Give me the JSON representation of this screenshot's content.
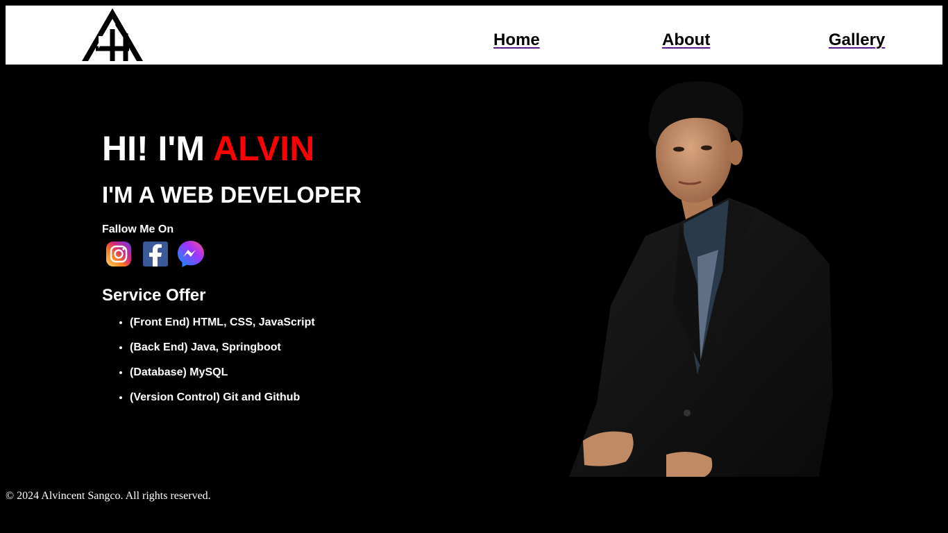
{
  "header": {
    "logo": {
      "icon": "ah-monogram-logo"
    },
    "nav": [
      {
        "label": "Home"
      },
      {
        "label": "About"
      },
      {
        "label": "Gallery"
      }
    ]
  },
  "hero": {
    "greeting_prefix": "HI! I'M ",
    "greeting_name": "ALVIN",
    "role": "I'M A WEB DEVELOPER",
    "follow_label": "Fallow Me On",
    "socials": [
      {
        "icon": "instagram-icon"
      },
      {
        "icon": "facebook-icon"
      },
      {
        "icon": "messenger-icon"
      }
    ],
    "services_title": "Service Offer",
    "services": [
      "(Front End) HTML, CSS, JavaScript",
      "(Back End) Java, Springboot",
      "(Database) MySQL",
      "(Version Control) Git and Github"
    ]
  },
  "portrait": {
    "subject": "portrait-photo"
  },
  "footer": {
    "text": "© 2024 Alvincent Sangco. All rights reserved."
  },
  "colors": {
    "accent": "#ff0000",
    "background": "#000000",
    "header": "#ffffff",
    "link_underline": "#551a8b"
  }
}
